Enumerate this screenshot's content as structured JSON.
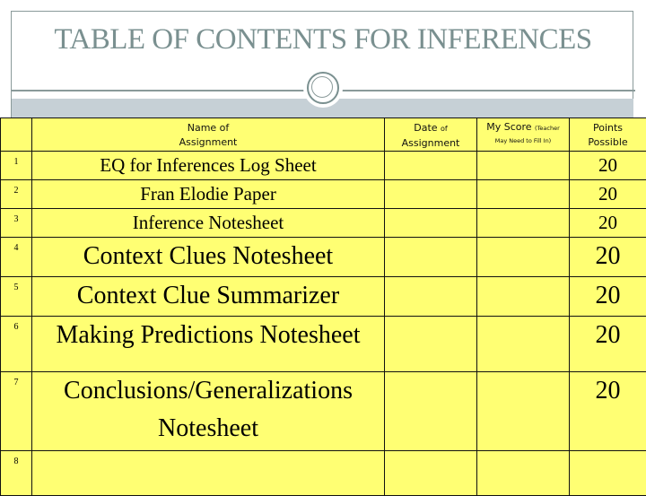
{
  "title": "TABLE OF CONTENTS FOR INFERENCES",
  "colors": {
    "table_bg": "#ffff73",
    "title_color": "#7a9090",
    "band_color": "#c6d0d6",
    "grid_line": "#111111"
  },
  "table": {
    "headers": {
      "number": "",
      "name_line1": "Name of",
      "name_line2": "Assignment",
      "date_main": "Date",
      "date_small": "of",
      "date_tail": "Assignment",
      "score_main": "My Score",
      "score_small": "(Teacher",
      "score_line2": "May Need to Fill In)",
      "points_line1": "Points",
      "points_line2": "Possible"
    },
    "rows": [
      {
        "number": "1",
        "name": "EQ for Inferences Log Sheet",
        "name_line2": "",
        "date": "",
        "score": "",
        "points": "20"
      },
      {
        "number": "2",
        "name": "Fran Elodie Paper",
        "name_line2": "",
        "date": "",
        "score": "",
        "points": "20"
      },
      {
        "number": "3",
        "name": "Inference Notesheet",
        "name_line2": "",
        "date": "",
        "score": "",
        "points": "20"
      },
      {
        "number": "4",
        "name": "Context Clues Notesheet",
        "name_line2": "",
        "date": "",
        "score": "",
        "points": "20"
      },
      {
        "number": "5",
        "name": "Context Clue Summarizer",
        "name_line2": "",
        "date": "",
        "score": "",
        "points": "20"
      },
      {
        "number": "6",
        "name": "Making Predictions Notesheet",
        "name_line2": "",
        "date": "",
        "score": "",
        "points": "20"
      },
      {
        "number": "7",
        "name": "Conclusions/Generalizations",
        "name_line2": "Notesheet",
        "date": "",
        "score": "",
        "points": "20"
      },
      {
        "number": "8",
        "name": "",
        "name_line2": "",
        "date": "",
        "score": "",
        "points": ""
      }
    ]
  }
}
